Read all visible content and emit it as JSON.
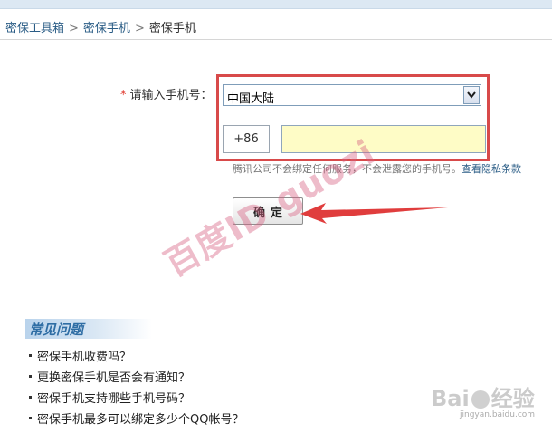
{
  "breadcrumb": {
    "items": [
      "密保工具箱",
      "密保手机",
      "密保手机"
    ],
    "separator": ">"
  },
  "form": {
    "required_mark": "*",
    "phone_label": "请输入手机号：",
    "region": {
      "selected": "中国大陆"
    },
    "country_code": "+86",
    "phone_value": "",
    "hint_text": "腾讯公司不会绑定任何服务，不会泄露您的手机号。",
    "privacy_link": "查看隐私条款",
    "confirm_label": "确定"
  },
  "faq": {
    "title": "常见问题",
    "items": [
      "密保手机收费吗？",
      "更换密保手机是否会有通知？",
      "密保手机支持哪些手机号码？",
      "密保手机最多可以绑定多少个QQ帐号？"
    ]
  },
  "watermark": {
    "text": "百度ID guozi",
    "logo_text_left": "Bai",
    "logo_text_right": "经验",
    "logo_sub": "jingyan.baidu.com"
  },
  "colors": {
    "link": "#2b5d86",
    "highlight_border": "#d84a4a",
    "phone_bg": "#fefcc6",
    "arrow": "#e03d3d"
  },
  "icons": {
    "dropdown": "chevron-down-icon",
    "annotation": "red-arrow-icon"
  }
}
